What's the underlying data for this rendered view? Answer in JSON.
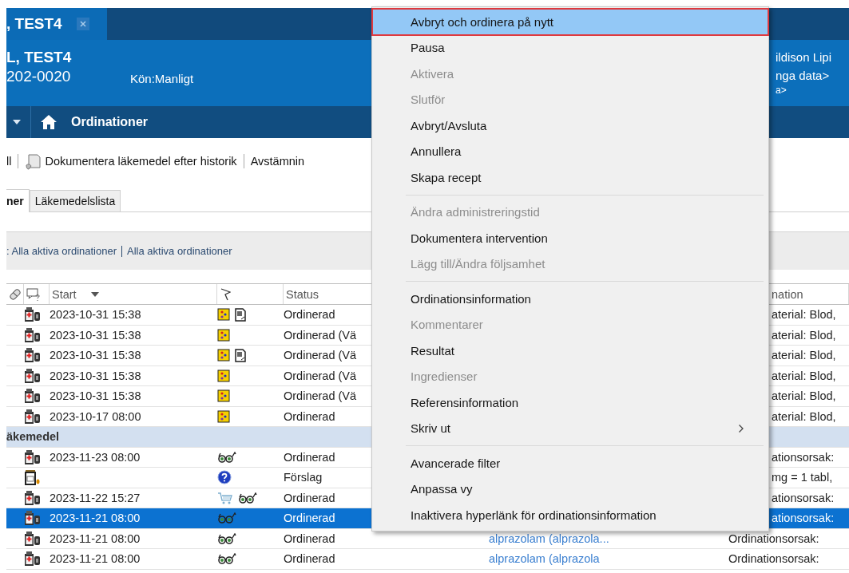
{
  "window_tabs": [
    {
      "label": ", TEST4",
      "selected": true
    }
  ],
  "patient": {
    "name": "L, TEST4",
    "id": "202-0020",
    "gender": "Kön:Manligt",
    "info_lines": [
      "ildison Lipi",
      "nga data>",
      "a>"
    ]
  },
  "nav": {
    "title": "Ordinationer"
  },
  "toolbar": {
    "items": [
      {
        "label": "ll",
        "icon": false
      },
      {
        "label": "Dokumentera läkemedel efter historik",
        "icon": true
      },
      {
        "label": "Avstämnin",
        "icon": false
      }
    ]
  },
  "tabs": [
    {
      "label": "ner",
      "selected": true
    },
    {
      "label": "Läkemedelslista",
      "selected": false
    }
  ],
  "filter": {
    "label": ": Alla aktiva ordinationer",
    "link": "Alla aktiva ordinationer"
  },
  "table": {
    "columns": [
      {
        "kind": "pill"
      },
      {
        "kind": "comment"
      },
      {
        "kind": "text",
        "label": "Start",
        "sorted": true
      },
      {
        "kind": "flag"
      },
      {
        "kind": "text",
        "label": "Status",
        "sorted": false
      },
      {
        "kind": "blank"
      },
      {
        "kind": "text",
        "label": "nation",
        "sorted": false
      }
    ],
    "rows": [
      {
        "kind": "order",
        "start": "2023-10-31 15:38",
        "flags": [
          {
            "kind": "lab"
          },
          {
            "kind": "note"
          }
        ],
        "status": "Ordinerad",
        "details": "aterial: Blod,",
        "selected": false
      },
      {
        "kind": "order",
        "start": "2023-10-31 15:38",
        "flags": [
          {
            "kind": "lab"
          }
        ],
        "status": "Ordinerad (Vä",
        "details": "aterial: Blod,",
        "selected": false
      },
      {
        "kind": "order",
        "start": "2023-10-31 15:38",
        "flags": [
          {
            "kind": "lab"
          },
          {
            "kind": "note"
          }
        ],
        "status": "Ordinerad (Vä",
        "details": "aterial: Blod,",
        "selected": false
      },
      {
        "kind": "order",
        "start": "2023-10-31 15:38",
        "flags": [
          {
            "kind": "lab"
          }
        ],
        "status": "Ordinerad (Vä",
        "details": "aterial: Blod,",
        "selected": false
      },
      {
        "kind": "order",
        "start": "2023-10-31 15:38",
        "flags": [
          {
            "kind": "lab"
          }
        ],
        "status": "Ordinerad (Vä",
        "details": "aterial: Blod,",
        "selected": false
      },
      {
        "kind": "order",
        "start": "2023-10-17 08:00",
        "flags": [
          {
            "kind": "lab"
          }
        ],
        "status": "Ordinerad",
        "details": "aterial: Blod,",
        "selected": false
      },
      {
        "kind": "group",
        "label": "äkemedel"
      },
      {
        "kind": "order",
        "start": "2023-11-23 08:00",
        "flags": [
          {
            "kind": "glasses"
          }
        ],
        "status": "Ordinerad",
        "details": "ationsorsak:",
        "selected": false
      },
      {
        "kind": "proposal",
        "flags": [
          {
            "kind": "help"
          }
        ],
        "status": "Förslag",
        "details": "mg = 1 tabl,",
        "selected": false
      },
      {
        "kind": "order",
        "start": "2023-11-22 15:27",
        "flags": [
          {
            "kind": "cart"
          },
          {
            "kind": "glasses"
          }
        ],
        "status": "Ordinerad",
        "details": "ationsorsak:",
        "selected": false
      },
      {
        "kind": "order",
        "start": "2023-11-21 08:00",
        "flags": [
          {
            "kind": "glasses"
          }
        ],
        "status": "Ordinerad",
        "details": "ationsorsak:",
        "selected": true
      },
      {
        "kind": "order",
        "start": "2023-11-21 08:00",
        "flags": [
          {
            "kind": "glasses"
          }
        ],
        "status": "Ordinerad",
        "order_name": "alprazolam (alprazola...",
        "details": "Ordinationsorsak:",
        "selected": false
      },
      {
        "kind": "order",
        "start": "2023-11-21 08:00",
        "flags": [
          {
            "kind": "glasses"
          }
        ],
        "status": "Ordinerad",
        "order_name": "alprazolam (alprazola",
        "details": "Ordinationsorsak:",
        "selected": false
      }
    ]
  },
  "context_menu": {
    "groups": [
      [
        {
          "label": "Avbryt och ordinera på nytt",
          "selected": true,
          "disabled": false,
          "submenu": false
        },
        {
          "label": "Pausa",
          "selected": false,
          "disabled": false,
          "submenu": false
        },
        {
          "label": "Aktivera",
          "selected": false,
          "disabled": true,
          "submenu": false
        },
        {
          "label": "Slutför",
          "selected": false,
          "disabled": true,
          "submenu": false
        },
        {
          "label": "Avbryt/Avsluta",
          "selected": false,
          "disabled": false,
          "submenu": false
        },
        {
          "label": "Annullera",
          "selected": false,
          "disabled": false,
          "submenu": false
        },
        {
          "label": "Skapa recept",
          "selected": false,
          "disabled": false,
          "submenu": false
        }
      ],
      [
        {
          "label": "Ändra administreringstid",
          "selected": false,
          "disabled": true,
          "submenu": false
        },
        {
          "label": "Dokumentera intervention",
          "selected": false,
          "disabled": false,
          "submenu": false
        },
        {
          "label": "Lägg till/Ändra följsamhet",
          "selected": false,
          "disabled": true,
          "submenu": false
        }
      ],
      [
        {
          "label": "Ordinationsinformation",
          "selected": false,
          "disabled": false,
          "submenu": false
        },
        {
          "label": "Kommentarer",
          "selected": false,
          "disabled": true,
          "submenu": false
        },
        {
          "label": "Resultat",
          "selected": false,
          "disabled": false,
          "submenu": false
        },
        {
          "label": "Ingredienser",
          "selected": false,
          "disabled": true,
          "submenu": false
        },
        {
          "label": "Referensinformation",
          "selected": false,
          "disabled": false,
          "submenu": false
        },
        {
          "label": "Skriv ut",
          "selected": false,
          "disabled": false,
          "submenu": true
        }
      ],
      [
        {
          "label": "Avancerade filter",
          "selected": false,
          "disabled": false,
          "submenu": false
        },
        {
          "label": "Anpassa vy",
          "selected": false,
          "disabled": false,
          "submenu": false
        },
        {
          "label": "Inaktivera hyperlänk för ordinationsinformation",
          "selected": false,
          "disabled": false,
          "submenu": false
        }
      ]
    ]
  }
}
